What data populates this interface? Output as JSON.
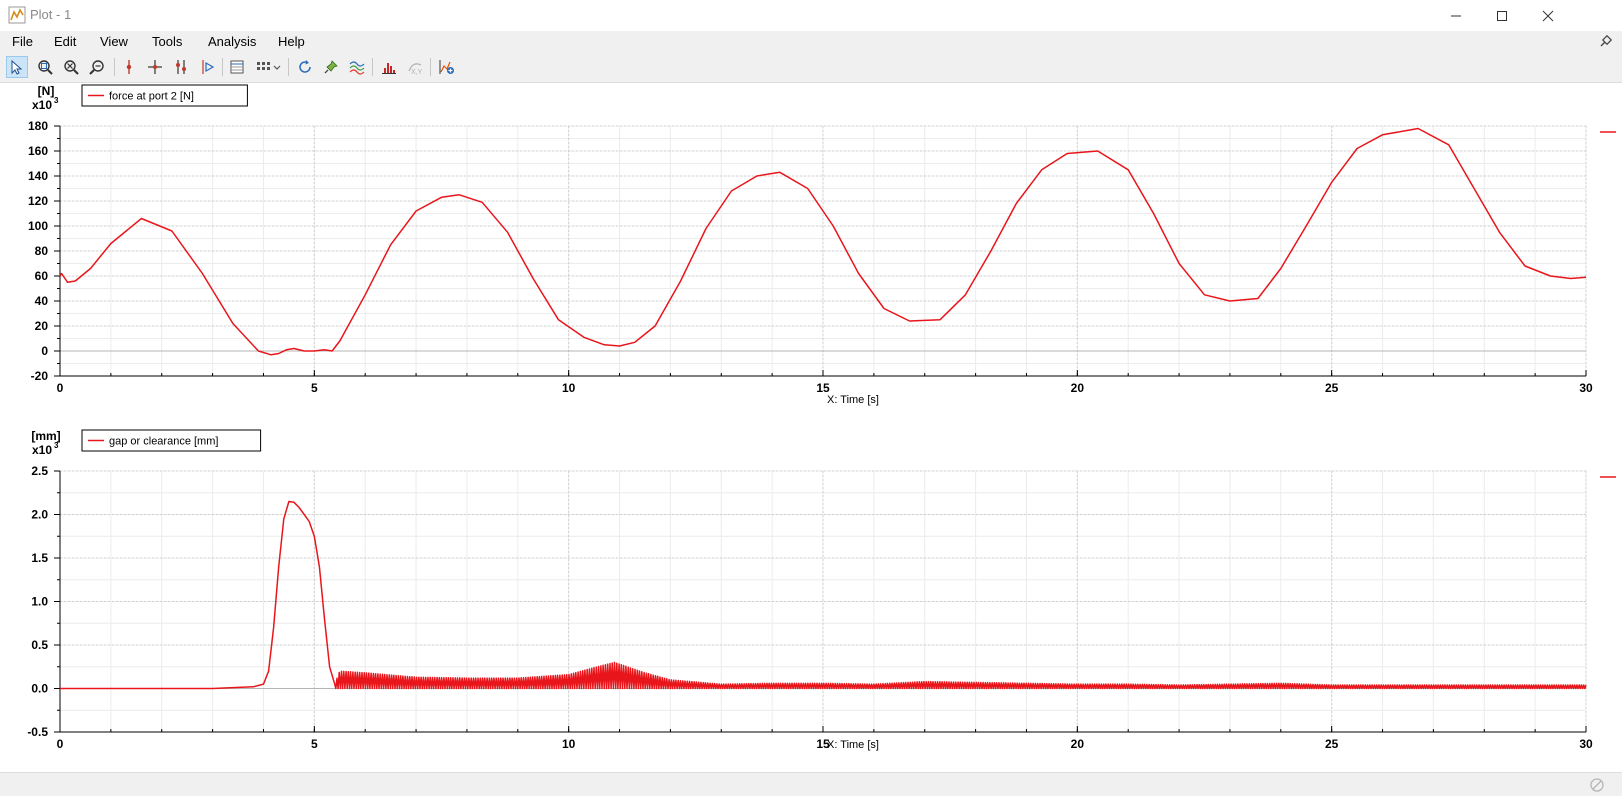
{
  "window": {
    "title": "Plot - 1"
  },
  "menu": [
    "File",
    "Edit",
    "View",
    "Tools",
    "Analysis",
    "Help"
  ],
  "toolbar_icons": [
    "select-pointer",
    "zoom-box",
    "zoom-out",
    "zoom-fit",
    "marker-vertical",
    "crosshair",
    "multi-marker",
    "step-play",
    "data-table",
    "grid-layout",
    "refresh",
    "pin-marker",
    "curve-style",
    "histogram",
    "xy-disabled",
    "add-plot"
  ],
  "colors": {
    "series": "#e8161b",
    "grid": "#d0d0d0",
    "zero_line": "#b4b4b4"
  },
  "chart_data": [
    {
      "type": "line",
      "ylabel": "[N]",
      "ymult": "x10",
      "ymult_exp": "3",
      "xlabel": "X: Time [s]",
      "xlim": [
        0,
        30
      ],
      "ylim": [
        -20,
        180
      ],
      "xticks": [
        0,
        5,
        10,
        15,
        20,
        25,
        30
      ],
      "xtick_labels": [
        "0",
        "5",
        "10",
        "15",
        "20",
        "25",
        "30"
      ],
      "yticks": [
        -20,
        0,
        20,
        40,
        60,
        80,
        100,
        120,
        140,
        160,
        180
      ],
      "ytick_labels": [
        "-20",
        "0",
        "20",
        "40",
        "60",
        "80",
        "100",
        "120",
        "140",
        "160",
        "180"
      ],
      "grid": true,
      "legend_position": "top-left",
      "series": [
        {
          "name": "force at port 2 [N]",
          "x": [
            0,
            0.03,
            0.15,
            0.3,
            0.6,
            1.0,
            1.6,
            2.2,
            2.8,
            3.4,
            3.9,
            4.15,
            4.3,
            4.45,
            4.6,
            4.8,
            5.0,
            5.2,
            5.35,
            5.5,
            6.0,
            6.5,
            7.0,
            7.5,
            7.85,
            8.3,
            8.8,
            9.3,
            9.8,
            10.3,
            10.7,
            11.0,
            11.3,
            11.7,
            12.2,
            12.7,
            13.2,
            13.7,
            14.15,
            14.7,
            15.2,
            15.7,
            16.2,
            16.7,
            17.3,
            17.8,
            18.3,
            18.8,
            19.3,
            19.8,
            20.4,
            21.0,
            21.5,
            22.0,
            22.5,
            23.0,
            23.55,
            24.0,
            24.5,
            25.0,
            25.5,
            26.0,
            26.7,
            27.3,
            27.8,
            28.3,
            28.8,
            29.3,
            29.7,
            30.0
          ],
          "y": [
            60,
            62,
            55,
            56,
            66,
            86,
            106,
            96,
            62,
            22,
            0,
            -3,
            -2,
            1,
            2,
            0,
            0,
            1,
            0,
            8,
            45,
            85,
            112,
            123,
            125,
            119,
            95,
            58,
            25,
            11,
            5,
            4,
            7,
            20,
            56,
            98,
            128,
            140,
            143,
            130,
            100,
            62,
            34,
            24,
            25,
            45,
            80,
            118,
            145,
            158,
            160,
            145,
            110,
            70,
            45,
            40,
            42,
            66,
            100,
            135,
            162,
            173,
            178,
            165,
            130,
            95,
            68,
            60,
            58,
            59
          ]
        }
      ]
    },
    {
      "type": "line",
      "ylabel": "[mm]",
      "ymult": "x10",
      "ymult_exp": "3",
      "xlabel": "X: Time [s]",
      "xlim": [
        0,
        30
      ],
      "ylim": [
        -0.5,
        2.5
      ],
      "xticks": [
        0,
        5,
        10,
        15,
        20,
        25,
        30
      ],
      "xtick_labels": [
        "0",
        "5",
        "10",
        "15",
        "20",
        "25",
        "30"
      ],
      "yticks": [
        -0.5,
        0.0,
        0.5,
        1.0,
        1.5,
        2.0,
        2.5
      ],
      "ytick_labels": [
        "-0.5",
        "0.0",
        "0.5",
        "1.0",
        "1.5",
        "2.0",
        "2.5"
      ],
      "grid": true,
      "legend_position": "top-left",
      "series": [
        {
          "name": "gap or clearance [mm]",
          "x": [
            0,
            1,
            2,
            3,
            3.8,
            4.0,
            4.1,
            4.2,
            4.3,
            4.4,
            4.5,
            4.6,
            4.7,
            4.8,
            4.9,
            5.0,
            5.1,
            5.2,
            5.3,
            5.4,
            5.5,
            6,
            7,
            8,
            9,
            10,
            10.5,
            10.9,
            11.5,
            12,
            13,
            14,
            15,
            16,
            17,
            18,
            19,
            20,
            21,
            22,
            23,
            24,
            25,
            26,
            27,
            28,
            29,
            30
          ],
          "y": [
            0,
            0,
            0,
            0,
            0.02,
            0.05,
            0.2,
            0.7,
            1.4,
            1.95,
            2.15,
            2.14,
            2.08,
            2.0,
            1.92,
            1.75,
            1.4,
            0.8,
            0.25,
            0.05,
            0.2,
            0.18,
            0.13,
            0.12,
            0.12,
            0.16,
            0.24,
            0.3,
            0.18,
            0.1,
            0.05,
            0.06,
            0.06,
            0.05,
            0.08,
            0.07,
            0.06,
            0.05,
            0.05,
            0.04,
            0.05,
            0.06,
            0.04,
            0.04,
            0.04,
            0.04,
            0.04,
            0.04
          ],
          "oscillation_range": [
            5.4,
            30
          ]
        }
      ]
    }
  ]
}
